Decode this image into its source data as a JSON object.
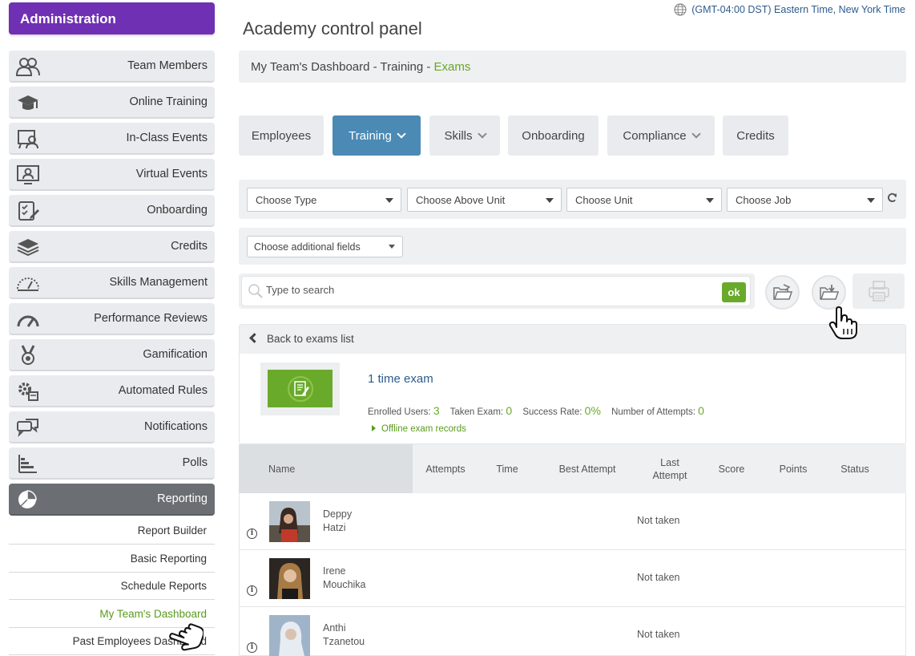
{
  "sidebar": {
    "header": "Administration",
    "items": [
      {
        "label": "Team Members",
        "icon": "team-members-icon"
      },
      {
        "label": "Online Training",
        "icon": "graduation-cap-icon"
      },
      {
        "label": "In-Class Events",
        "icon": "in-class-events-icon"
      },
      {
        "label": "Virtual Events",
        "icon": "virtual-events-icon"
      },
      {
        "label": "Onboarding",
        "icon": "onboarding-checklist-icon"
      },
      {
        "label": "Credits",
        "icon": "credits-layers-icon"
      },
      {
        "label": "Skills Management",
        "icon": "gauge-icon"
      },
      {
        "label": "Performance Reviews",
        "icon": "speedometer-icon"
      },
      {
        "label": "Gamification",
        "icon": "medal-icon"
      },
      {
        "label": "Automated Rules",
        "icon": "gear-rules-icon"
      },
      {
        "label": "Notifications",
        "icon": "chat-bubbles-icon"
      },
      {
        "label": "Polls",
        "icon": "bar-chart-icon"
      },
      {
        "label": "Reporting",
        "icon": "pie-chart-icon"
      }
    ],
    "reporting_sub": [
      {
        "label": "Report Builder"
      },
      {
        "label": "Basic Reporting"
      },
      {
        "label": "Schedule Reports"
      },
      {
        "label": "My Team's Dashboard"
      },
      {
        "label": "Past Employees Dashboard"
      }
    ]
  },
  "header": {
    "timezone": "(GMT-04:00 DST) Eastern Time, New York Time",
    "title": "Academy control panel"
  },
  "breadcrumb": {
    "part1": "My Team's Dashboard - Training - ",
    "part2": "Exams"
  },
  "tabs": [
    {
      "label": "Employees"
    },
    {
      "label": "Training"
    },
    {
      "label": "Skills"
    },
    {
      "label": "Onboarding"
    },
    {
      "label": "Compliance"
    },
    {
      "label": "Credits"
    }
  ],
  "filters": {
    "type": "Choose Type",
    "above_unit": "Choose Above Unit",
    "unit": "Choose Unit",
    "job": "Choose Job",
    "additional": "Choose additional fields"
  },
  "search": {
    "placeholder": "Type to search",
    "ok": "ok"
  },
  "exam": {
    "back": "Back to exams list",
    "name": "1 time exam",
    "enrolled_label": "Enrolled Users:",
    "enrolled": "3",
    "taken_label": "Taken Exam:",
    "taken": "0",
    "success_label": "Success Rate:",
    "success": "0%",
    "attempts_label": "Number of Attempts:",
    "attempts": "0",
    "offline": "Offline exam records"
  },
  "table": {
    "headers": {
      "name": "Name",
      "attempts": "Attempts",
      "time": "Time",
      "best": "Best Attempt",
      "last1": "Last",
      "last2": "Attempt",
      "score": "Score",
      "points": "Points",
      "status": "Status"
    },
    "rows": [
      {
        "first": "Deppy",
        "last": "Hatzi",
        "status": "Not taken"
      },
      {
        "first": "Irene",
        "last": "Mouchika",
        "status": "Not taken"
      },
      {
        "first": "Anthi",
        "last": "Tzanetou",
        "status": "Not taken"
      }
    ]
  },
  "colors": {
    "brand_purple": "#6f30b4",
    "active_tab": "#4a8ab4",
    "accent_green": "#6aaa2a",
    "link_blue": "#2d5b8c"
  }
}
